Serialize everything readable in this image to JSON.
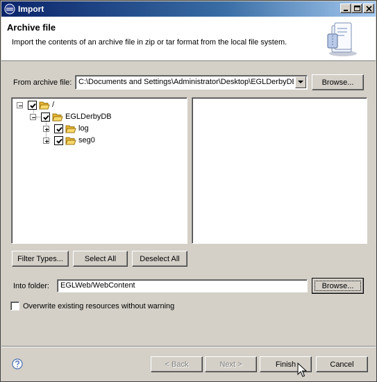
{
  "window": {
    "title": "Import",
    "minimize_label": "minimize",
    "maximize_label": "maximize",
    "close_label": "close"
  },
  "banner": {
    "title": "Archive file",
    "description": "Import the contents of an archive file in zip or tar format from the local file system."
  },
  "source": {
    "label": "From archive file:",
    "value": "C:\\Documents and Settings\\Administrator\\Desktop\\EGLDerbyDB.zip",
    "browse_label": "Browse..."
  },
  "tree": {
    "items": [
      {
        "label": "/",
        "checked": true,
        "expanded": true
      },
      {
        "label": "EGLDerbyDB",
        "checked": true,
        "expanded": true
      },
      {
        "label": "log",
        "checked": true,
        "expanded": false
      },
      {
        "label": "seg0",
        "checked": true,
        "expanded": false
      }
    ]
  },
  "buttons": {
    "filter_types": "Filter Types...",
    "select_all": "Select All",
    "deselect_all": "Deselect All"
  },
  "destination": {
    "label": "Into folder:",
    "value": "EGLWeb/WebContent",
    "browse_label": "Browse..."
  },
  "overwrite": {
    "label": "Overwrite existing resources without warning",
    "checked": false
  },
  "footer": {
    "back": "< Back",
    "next": "Next >",
    "finish": "Finish",
    "cancel": "Cancel"
  },
  "colors": {
    "titlebar_start": "#0a246a",
    "titlebar_end": "#a6caf0",
    "face": "#d4d0c8",
    "folder": "#f5c242"
  }
}
